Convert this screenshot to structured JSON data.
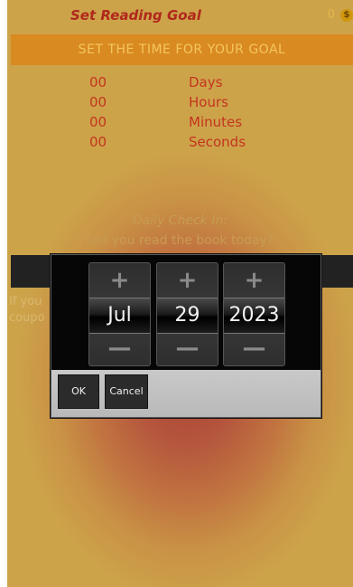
{
  "header": {
    "title": "Set Reading Goal",
    "coins": "0",
    "coin_icon": "coin-icon"
  },
  "goal_banner": {
    "label": "SET THE TIME FOR YOUR GOAL"
  },
  "time_rows": [
    {
      "value": "00",
      "unit": "Days"
    },
    {
      "value": "00",
      "unit": "Hours"
    },
    {
      "value": "00",
      "unit": "Minutes"
    },
    {
      "value": "00",
      "unit": "Seconds"
    }
  ],
  "checkin": {
    "title": "Daily Check In:",
    "question": "Did you read the book today?"
  },
  "partial_text": {
    "line1": "If you",
    "line2": "coupo"
  },
  "date_picker": {
    "month": {
      "plus": "+",
      "value": "Jul",
      "minus": "—"
    },
    "day": {
      "plus": "+",
      "value": "29",
      "minus": "—"
    },
    "year": {
      "plus": "+",
      "value": "2023",
      "minus": "—"
    },
    "ok_label": "OK",
    "cancel_label": "Cancel"
  }
}
